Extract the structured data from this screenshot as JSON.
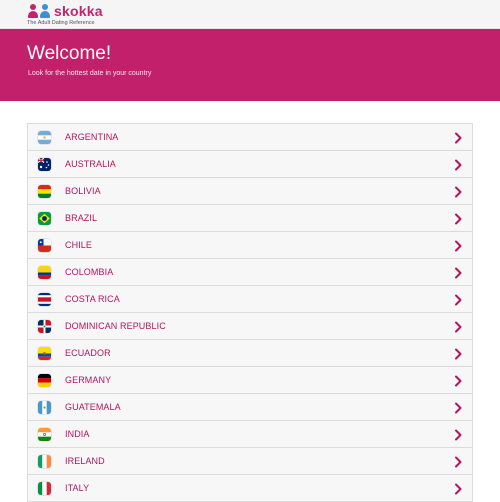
{
  "brand": {
    "name": "skokka",
    "tagline": "The Adult Dating Reference",
    "primary_color": "#c2206a",
    "secondary_color": "#3d8fd4"
  },
  "hero": {
    "title": "Welcome!",
    "subtitle": "Look for the hottest date in your country"
  },
  "countries": [
    {
      "name": "ARGENTINA",
      "flag": "argentina-flag-icon"
    },
    {
      "name": "AUSTRALIA",
      "flag": "australia-flag-icon"
    },
    {
      "name": "BOLIVIA",
      "flag": "bolivia-flag-icon"
    },
    {
      "name": "BRAZIL",
      "flag": "brazil-flag-icon"
    },
    {
      "name": "CHILE",
      "flag": "chile-flag-icon"
    },
    {
      "name": "COLOMBIA",
      "flag": "colombia-flag-icon"
    },
    {
      "name": "COSTA RICA",
      "flag": "costa-rica-flag-icon"
    },
    {
      "name": "DOMINICAN REPUBLIC",
      "flag": "dominican-republic-flag-icon"
    },
    {
      "name": "ECUADOR",
      "flag": "ecuador-flag-icon"
    },
    {
      "name": "GERMANY",
      "flag": "germany-flag-icon"
    },
    {
      "name": "GUATEMALA",
      "flag": "guatemala-flag-icon"
    },
    {
      "name": "INDIA",
      "flag": "india-flag-icon"
    },
    {
      "name": "IRELAND",
      "flag": "ireland-flag-icon"
    },
    {
      "name": "ITALY",
      "flag": "italy-flag-icon"
    }
  ]
}
